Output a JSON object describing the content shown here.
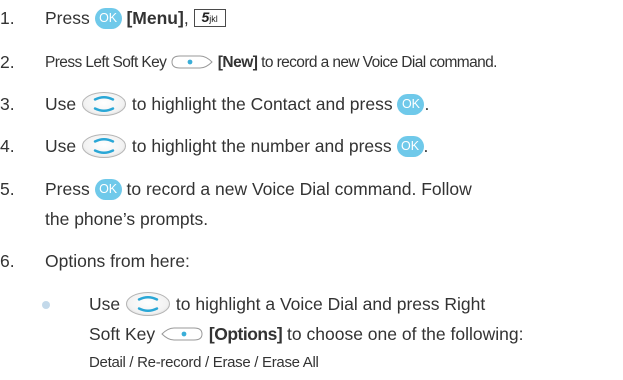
{
  "icons": {
    "ok": "ok-key-icon",
    "five": "number-5-key-icon",
    "nav": "navigation-key-icon",
    "softkey": "soft-key-icon"
  },
  "ok_label": "OK",
  "five_key": {
    "digit": "5",
    "letters": "jkl"
  },
  "steps": [
    {
      "num": "1.",
      "p1": "Press",
      "p2": "[Menu]",
      "p3": ","
    },
    {
      "num": "2.",
      "p1": "Press Left Soft Key",
      "p2": "[New]",
      "p3": "to record a new Voice Dial command."
    },
    {
      "num": "3.",
      "p1": "Use",
      "p2": "to highlight the Contact and press",
      "p3": "."
    },
    {
      "num": "4.",
      "p1": "Use",
      "p2": "to highlight the number and press",
      "p3": "."
    },
    {
      "num": "5.",
      "p1": "Press",
      "p2": "to record a new Voice Dial command. Follow",
      "line2": "the phone’s prompts."
    },
    {
      "num": "6.",
      "text": "Options from here:"
    }
  ],
  "sub": {
    "p1": "Use",
    "p2": "to highlight a Voice Dial and press Right",
    "line2a": "Soft Key",
    "line2b": "[Options]",
    "line2c": "to choose one of the following:",
    "line3": "Detail / Re-record / Erase / Erase All"
  },
  "colors": {
    "ok_blue": "#6fc9ea",
    "bullet": "#c3d9ea",
    "text": "#333333"
  }
}
